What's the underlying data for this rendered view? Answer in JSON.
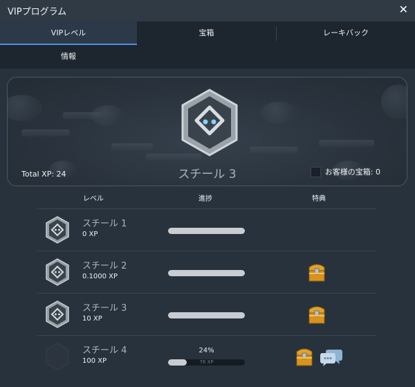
{
  "window": {
    "title": "VIPプログラム",
    "close_glyph": "✕"
  },
  "tabs": [
    {
      "label": "VIPレベル",
      "active": true
    },
    {
      "label": "宝箱",
      "active": false
    },
    {
      "label": "レーキバック",
      "active": false
    },
    {
      "label": "情報",
      "active": false
    }
  ],
  "hero": {
    "total_xp": "Total XP: 24",
    "level_name": "スチール 3",
    "chest_label": "お客様の宝箱: 0",
    "chest_checked": false
  },
  "table": {
    "headers": {
      "level": "レベル",
      "progress": "進捗",
      "perks": "特典"
    },
    "rows": [
      {
        "name": "スチール 1",
        "xp": "0 XP",
        "progress": 1.0,
        "rewards": []
      },
      {
        "name": "スチール 2",
        "xp": "0.1000 XP",
        "progress": 1.0,
        "rewards": [
          "chest-icon"
        ]
      },
      {
        "name": "スチール 3",
        "xp": "10 XP",
        "progress": 1.0,
        "rewards": [
          "chest-icon"
        ]
      },
      {
        "name": "スチール 4",
        "xp": "100 XP",
        "progress": 0.24,
        "percent_text": "24%",
        "bar_text": "76 XP",
        "rewards": [
          "chest-icon",
          "chat-icon"
        ]
      }
    ]
  },
  "colors": {
    "accent": "#4a8fe0",
    "background": "#28323d",
    "chest_gold": "#e0a32a"
  }
}
